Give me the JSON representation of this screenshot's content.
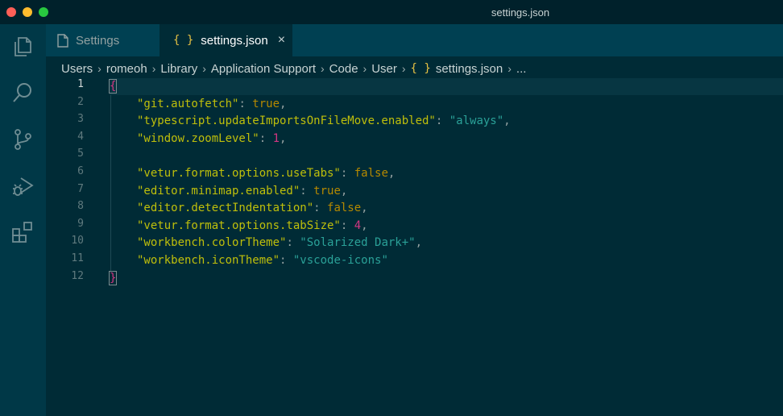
{
  "window": {
    "title": "settings.json"
  },
  "activity_bar": [
    {
      "name": "explorer-icon"
    },
    {
      "name": "search-icon"
    },
    {
      "name": "source-control-icon"
    },
    {
      "name": "run-debug-icon"
    },
    {
      "name": "extensions-icon"
    }
  ],
  "tabs": [
    {
      "label": "Settings",
      "icon": "file-icon",
      "active": false
    },
    {
      "label": "settings.json",
      "icon": "{ }",
      "active": true,
      "close": "×"
    }
  ],
  "breadcrumb": [
    "Users",
    "romeoh",
    "Library",
    "Application Support",
    "Code",
    "User",
    "settings.json",
    "..."
  ],
  "breadcrumb_icon": "{ }",
  "line_numbers": [
    "1",
    "2",
    "3",
    "4",
    "5",
    "6",
    "7",
    "8",
    "9",
    "10",
    "11",
    "12"
  ],
  "code": {
    "open": "{",
    "close": "}",
    "lines": [
      {
        "key": "\"git.autofetch\"",
        "value": "true",
        "type": "kw",
        "comma": ","
      },
      {
        "key": "\"typescript.updateImportsOnFileMove.enabled\"",
        "value": "\"always\"",
        "type": "str",
        "comma": ","
      },
      {
        "key": "\"window.zoomLevel\"",
        "value": "1",
        "type": "num",
        "comma": ","
      },
      {
        "key": "\"vetur.format.options.useTabs\"",
        "value": "false",
        "type": "kw",
        "comma": ","
      },
      {
        "key": "\"editor.minimap.enabled\"",
        "value": "true",
        "type": "kw",
        "comma": ","
      },
      {
        "key": "\"editor.detectIndentation\"",
        "value": "false",
        "type": "kw",
        "comma": ","
      },
      {
        "key": "\"vetur.format.options.tabSize\"",
        "value": "4",
        "type": "num",
        "comma": ","
      },
      {
        "key": "\"workbench.colorTheme\"",
        "value": "\"Solarized Dark+\"",
        "type": "str",
        "comma": ","
      },
      {
        "key": "\"workbench.iconTheme\"",
        "value": "\"vscode-icons\"",
        "type": "str",
        "comma": ""
      }
    ]
  },
  "colors": {
    "background": "#002b36",
    "key": "#bfbf0b",
    "string": "#2aa198",
    "keyword": "#b58900",
    "number": "#d33682"
  }
}
